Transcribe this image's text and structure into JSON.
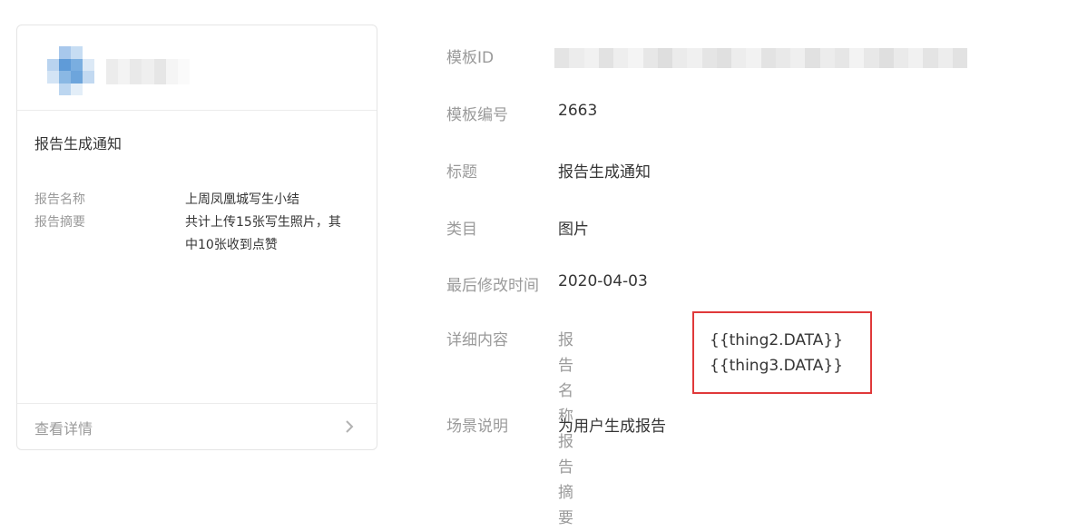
{
  "preview_card": {
    "title": "报告生成通知",
    "fields": [
      {
        "label": "报告名称",
        "value": "上周凤凰城写生小结"
      },
      {
        "label": "报告摘要",
        "value": "共计上传15张写生照片，其中10张收到点赞"
      }
    ],
    "footer_link": "查看详情"
  },
  "detail": {
    "template_id": {
      "label": "模板ID"
    },
    "template_number": {
      "label": "模板编号",
      "value": "2663"
    },
    "title": {
      "label": "标题",
      "value": "报告生成通知"
    },
    "category": {
      "label": "类目",
      "value": "图片"
    },
    "last_modified": {
      "label": "最后修改时间",
      "value": "2020-04-03"
    },
    "content": {
      "label": "详细内容",
      "items": [
        {
          "key": "报告名称",
          "value": "{{thing2.DATA}}"
        },
        {
          "key": "报告摘要",
          "value": "{{thing3.DATA}}"
        }
      ]
    },
    "scenario": {
      "label": "场景说明",
      "value": "为用户生成报告"
    }
  },
  "colors": {
    "highlight": "#e0393a",
    "label_gray": "#9a9a9a",
    "text_dark": "#353535"
  },
  "icons": [
    "chevron-right-icon"
  ]
}
